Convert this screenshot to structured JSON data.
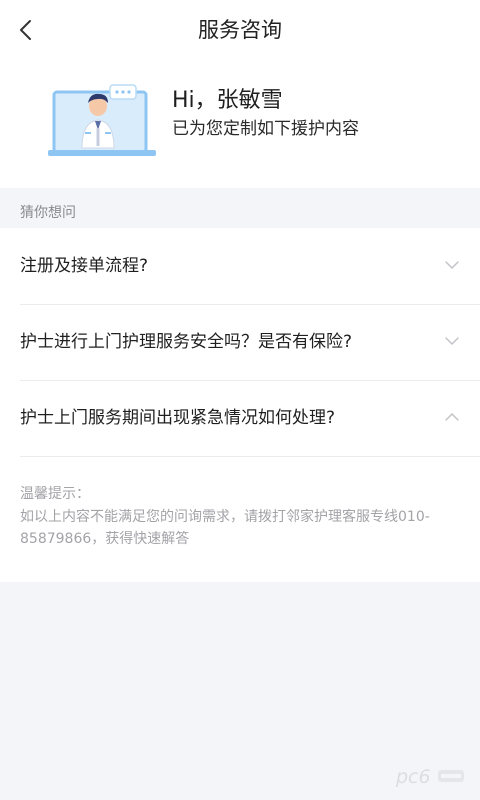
{
  "header": {
    "title": "服务咨询",
    "back_icon": "chevron-left-icon"
  },
  "hero": {
    "greeting": "Hi，张敏雪",
    "subtitle": "已为您定制如下援护内容",
    "illustration": "nurse-at-computer-illustration"
  },
  "faq": {
    "section_label": "猜你想问",
    "items": [
      {
        "question": "注册及接单流程?",
        "expanded": false,
        "icon": "chevron-down-icon"
      },
      {
        "question": "护士进行上门护理服务安全吗？是否有保险?",
        "expanded": false,
        "icon": "chevron-down-icon"
      },
      {
        "question": "护士上门服务期间出现紧急情况如何处理?",
        "expanded": true,
        "icon": "chevron-up-icon"
      }
    ]
  },
  "tip": {
    "title": "温馨提示：",
    "body": "如以上内容不能满足您的问询需求，请拨打邻家护理客服专线010-85879866，获得快速解答"
  },
  "watermark": {
    "text": "pc6",
    "icon": "pc6-watermark-logo"
  },
  "colors": {
    "background": "#f4f5f9",
    "card": "#ffffff",
    "divider": "#ececef",
    "muted_text": "#a3a3a8",
    "illustration_blue": "#8ec5f2"
  }
}
